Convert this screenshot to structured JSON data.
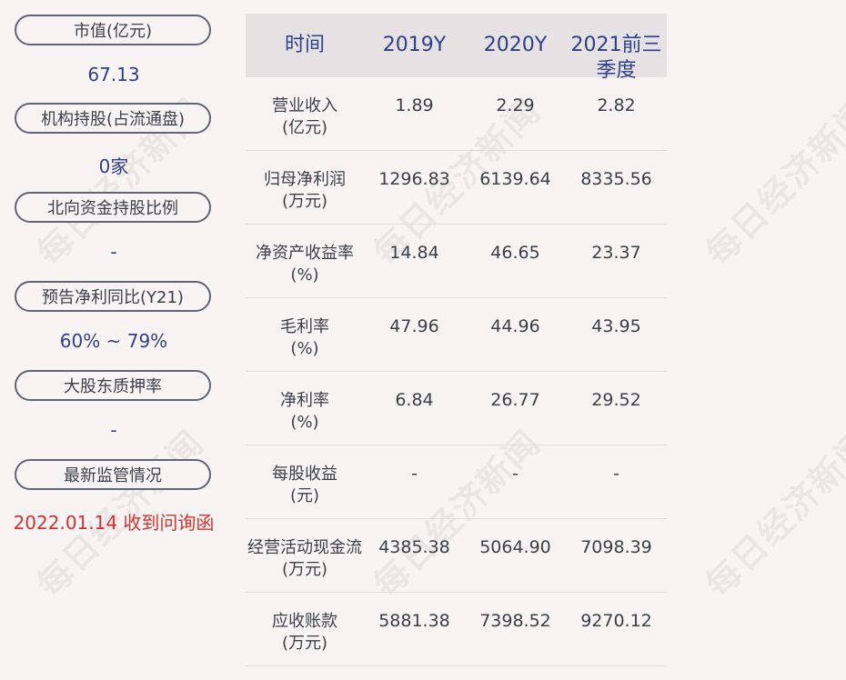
{
  "left_panel": [
    {
      "label": "市值(亿元)",
      "value": "67.13"
    },
    {
      "label": "机构持股(占流通盘)",
      "value": "0家"
    },
    {
      "label": "北向资金持股比例",
      "value": "-"
    },
    {
      "label": "预告净利同比(Y21)",
      "value": "60% ~ 79%"
    },
    {
      "label": "大股东质押率",
      "value": "-"
    },
    {
      "label": "最新监管情况",
      "value": "2022.01.14 收到问询函"
    }
  ],
  "table": {
    "headers": [
      "时间",
      "2019Y",
      "2020Y",
      "2021前三季度"
    ],
    "rows": [
      {
        "label": "营业收入",
        "unit": "(亿元)",
        "values": [
          "1.89",
          "2.29",
          "2.82"
        ]
      },
      {
        "label": "归母净利润",
        "unit": "(万元)",
        "values": [
          "1296.83",
          "6139.64",
          "8335.56"
        ]
      },
      {
        "label": "净资产收益率",
        "unit": "(%)",
        "values": [
          "14.84",
          "46.65",
          "23.37"
        ]
      },
      {
        "label": "毛利率",
        "unit": "(%)",
        "values": [
          "47.96",
          "44.96",
          "43.95"
        ]
      },
      {
        "label": "净利率",
        "unit": "(%)",
        "values": [
          "6.84",
          "26.77",
          "29.52"
        ]
      },
      {
        "label": "每股收益",
        "unit": "(元)",
        "values": [
          "-",
          "-",
          "-"
        ]
      },
      {
        "label": "经营活动现金流",
        "unit": "(万元)",
        "values": [
          "4385.38",
          "5064.90",
          "7098.39"
        ]
      },
      {
        "label": "应收账款",
        "unit": "(万元)",
        "values": [
          "5881.38",
          "7398.52",
          "9270.12"
        ]
      }
    ]
  },
  "watermark": "每日经济新闻",
  "colors": {
    "accent": "#2e3f8c",
    "alert": "#d8302c",
    "header_bg": "#e6e2e3",
    "background": "#f8f4f4"
  }
}
